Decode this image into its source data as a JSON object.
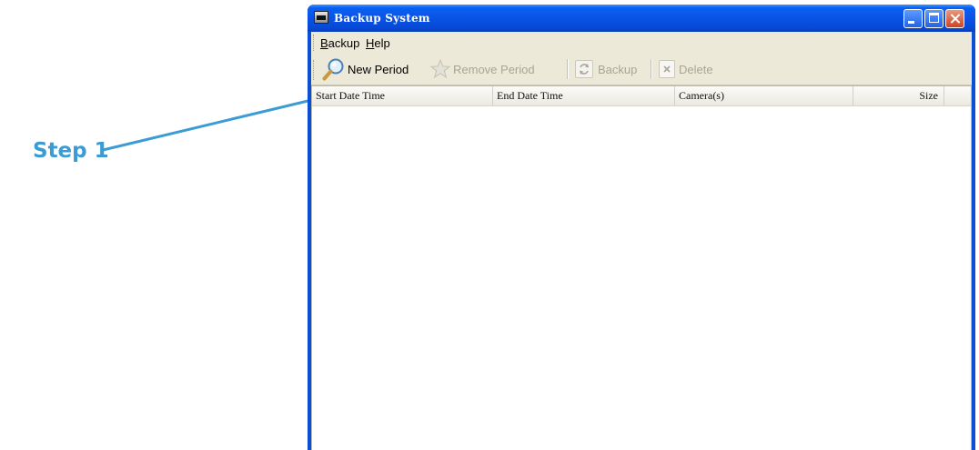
{
  "annotation": {
    "step_label": "Step 1",
    "color": "#3a9bd5"
  },
  "window": {
    "title": "Backup System",
    "title_bar_color": "#0a53e4",
    "controls": {
      "minimize": "minimize-icon",
      "maximize": "maximize-icon",
      "close": "close-icon"
    }
  },
  "menu": {
    "items": [
      {
        "label": "Backup",
        "mnemonic": "B"
      },
      {
        "label": "Help",
        "mnemonic": "H"
      }
    ]
  },
  "toolbar": {
    "new_period": {
      "label": "New Period",
      "icon": "magnify-icon",
      "enabled": true
    },
    "remove_period": {
      "label": "Remove Period",
      "icon": "star-icon",
      "enabled": false
    },
    "backup": {
      "label": "Backup",
      "icon": "refresh-icon",
      "enabled": false
    },
    "delete": {
      "label": "Delete",
      "icon": "delete-icon",
      "enabled": false
    }
  },
  "table": {
    "columns": [
      "Start Date Time",
      "End Date Time",
      "Camera(s)",
      "Size"
    ],
    "rows": []
  }
}
